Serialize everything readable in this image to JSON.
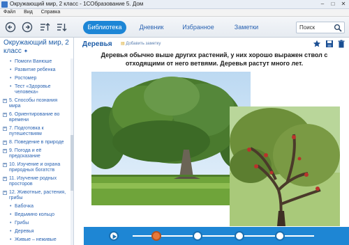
{
  "window": {
    "title": "Окружающий мир, 2 класс - 1СОбразование 5. Дом",
    "controls": [
      "–",
      "□",
      "✕"
    ]
  },
  "menu": [
    "Файл",
    "Вид",
    "Справка"
  ],
  "toolbar": {
    "tabs": [
      {
        "label": "Библиотека",
        "active": true
      },
      {
        "label": "Дневник",
        "active": false
      },
      {
        "label": "Избранное",
        "active": false
      },
      {
        "label": "Заметки",
        "active": false
      }
    ],
    "search_placeholder": "Поиск"
  },
  "sidebar": {
    "title": "Окружающий мир, 2 класс",
    "items": [
      {
        "label": "Помоги Ванюше",
        "level": 2
      },
      {
        "label": "Развитие ребенка",
        "level": 2
      },
      {
        "label": "Ростомер",
        "level": 2
      },
      {
        "label": "Тест «Здоровье человека»",
        "level": 2
      },
      {
        "label": "5. Способы познания мира",
        "level": 1
      },
      {
        "label": "6. Ориентирование во времени",
        "level": 1
      },
      {
        "label": "7. Подготовка к путешествиям",
        "level": 1
      },
      {
        "label": "8. Поведение в природе",
        "level": 1
      },
      {
        "label": "9. Погода и её предсказание",
        "level": 1
      },
      {
        "label": "10. Изучение и охрана природных богатств",
        "level": 1
      },
      {
        "label": "11. Изучение родных просторов",
        "level": 1
      },
      {
        "label": "12. Животные, растения, грибы",
        "level": 1
      },
      {
        "label": "Бабочка",
        "level": 2
      },
      {
        "label": "Ведьмино кольцо",
        "level": 2
      },
      {
        "label": "Грибы",
        "level": 2
      },
      {
        "label": "Деревья",
        "level": 2
      },
      {
        "label": "Живые – неживые",
        "level": 2
      }
    ]
  },
  "content": {
    "title": "Деревья",
    "add_note": "Добавить заметку",
    "lead_text": "Деревья обычно выше других растений, у них хорошо выражен ствол с отходящими от него ветвями. Деревья растут много лет."
  },
  "colors": {
    "accent": "#1d86d6",
    "link": "#2a63b2",
    "player": "#1e86d4",
    "current_slide": "#e7793a"
  },
  "player": {
    "slides": 5,
    "current": 1
  }
}
